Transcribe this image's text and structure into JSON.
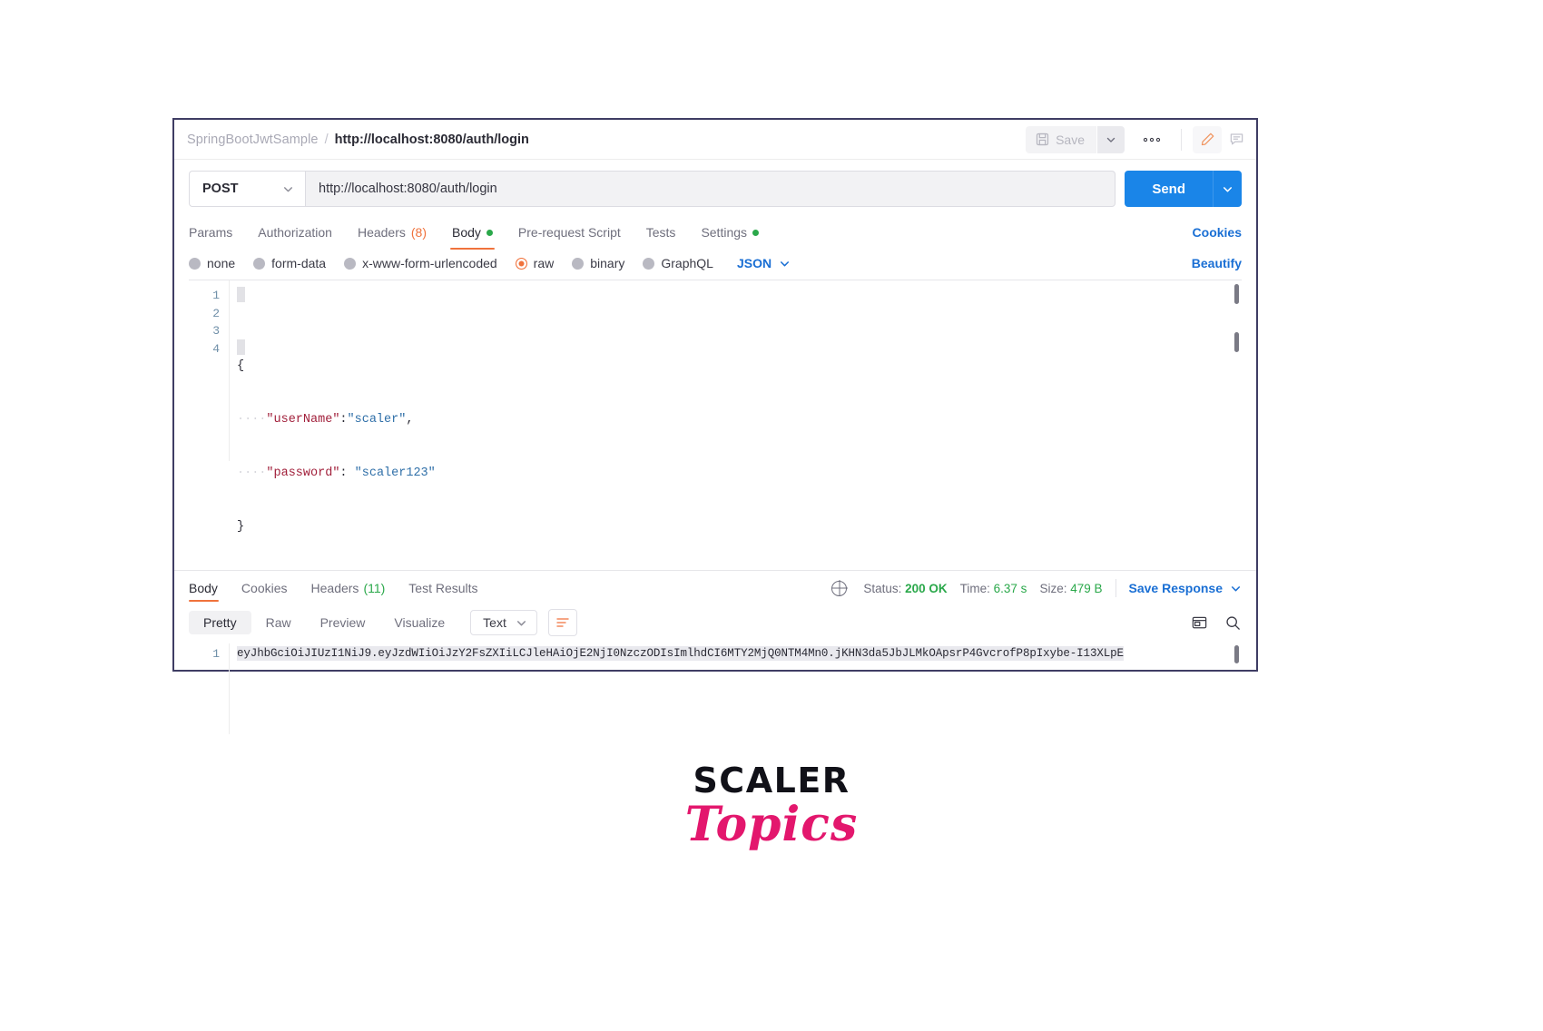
{
  "header": {
    "collection_name": "SpringBootJwtSample",
    "separator": "/",
    "request_name": "http://localhost:8080/auth/login",
    "save_label": "Save",
    "save_icon": "floppy-disk-icon",
    "save_caret_icon": "chevron-down-icon",
    "more_icon": "ellipsis-icon",
    "edit_icon": "pencil-icon",
    "comment_icon": "comment-icon"
  },
  "url_bar": {
    "method": "POST",
    "method_caret_icon": "chevron-down-icon",
    "url": "http://localhost:8080/auth/login",
    "send_label": "Send",
    "send_caret_icon": "chevron-down-icon"
  },
  "request_tabs": {
    "items": [
      {
        "label": "Params",
        "count": "",
        "dot": false,
        "active": false
      },
      {
        "label": "Authorization",
        "count": "",
        "dot": false,
        "active": false
      },
      {
        "label": "Headers",
        "count": "(8)",
        "dot": false,
        "active": false
      },
      {
        "label": "Body",
        "count": "",
        "dot": true,
        "active": true
      },
      {
        "label": "Pre-request Script",
        "count": "",
        "dot": false,
        "active": false
      },
      {
        "label": "Tests",
        "count": "",
        "dot": false,
        "active": false
      },
      {
        "label": "Settings",
        "count": "",
        "dot": true,
        "active": false
      }
    ],
    "cookies_link": "Cookies"
  },
  "body_options": {
    "radios": [
      {
        "label": "none",
        "selected": false
      },
      {
        "label": "form-data",
        "selected": false
      },
      {
        "label": "x-www-form-urlencoded",
        "selected": false
      },
      {
        "label": "raw",
        "selected": true
      },
      {
        "label": "binary",
        "selected": false
      },
      {
        "label": "GraphQL",
        "selected": false
      }
    ],
    "format": "JSON",
    "format_caret_icon": "chevron-down-icon",
    "beautify_label": "Beautify"
  },
  "request_body": {
    "line_numbers": [
      "1",
      "2",
      "3",
      "4"
    ],
    "lines": [
      {
        "indent": "",
        "key": "",
        "text": "{"
      },
      {
        "indent": "····",
        "key": "\"userName\"",
        "colon": ":",
        "value": "\"scaler\"",
        "tail": ","
      },
      {
        "indent": "····",
        "key": "\"password\"",
        "colon": ":",
        "space": " ",
        "value": "\"scaler123\"",
        "tail": ""
      },
      {
        "indent": "",
        "key": "",
        "text": "}"
      }
    ]
  },
  "response_tabs": {
    "items": [
      {
        "label": "Body",
        "count": "",
        "active": true
      },
      {
        "label": "Cookies",
        "count": "",
        "active": false
      },
      {
        "label": "Headers",
        "count": "(11)",
        "active": false
      },
      {
        "label": "Test Results",
        "count": "",
        "active": false
      }
    ]
  },
  "response_status": {
    "globe_icon": "globe-icon",
    "status_label": "Status:",
    "status_value": "200 OK",
    "time_label": "Time:",
    "time_value": "6.37 s",
    "size_label": "Size:",
    "size_value": "479 B",
    "save_response_label": "Save Response",
    "save_response_caret_icon": "chevron-down-icon"
  },
  "response_toolbar": {
    "view_modes": [
      {
        "label": "Pretty",
        "active": true
      },
      {
        "label": "Raw",
        "active": false
      },
      {
        "label": "Preview",
        "active": false
      },
      {
        "label": "Visualize",
        "active": false
      }
    ],
    "format": "Text",
    "format_caret_icon": "chevron-down-icon",
    "wrap_icon": "word-wrap-icon",
    "copy_icon": "copy-icon",
    "search_icon": "search-icon"
  },
  "response_body": {
    "line_number": "1",
    "token": "eyJhbGciOiJIUzI1NiJ9.eyJzdWIiOiJzY2FsZXIiLCJleHAiOjE2NjI0NzczODIsImlhdCI6MTY2MjQ0NTM4Mn0.jKHN3da5JbJLMkOApsrP4GvcrofP8pIxybe-I13XLpE"
  },
  "branding": {
    "primary": "SCALER",
    "secondary": "Topics"
  },
  "colors": {
    "accent_orange": "#f0723c",
    "link_blue": "#1a6fd4",
    "send_blue": "#1a85e8",
    "status_green": "#2aa84a",
    "window_border": "#3f3d64",
    "brand_pink": "#e3176d"
  }
}
